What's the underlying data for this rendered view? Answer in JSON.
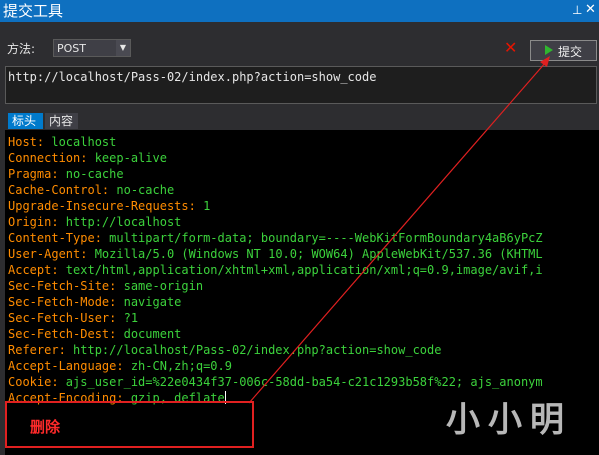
{
  "window": {
    "title": "提交工具",
    "pin_glyph": "⊥",
    "close_glyph": "✕"
  },
  "toolbar": {
    "method_label": "方法:",
    "method_value": "POST",
    "clear_glyph": "✕",
    "submit_label": "提交"
  },
  "url": "http://localhost/Pass-02/index.php?action=show_code",
  "tabs": [
    {
      "label": "标头",
      "active": true
    },
    {
      "label": "内容",
      "active": false
    }
  ],
  "headers": [
    {
      "k": "Host:",
      "v": " localhost"
    },
    {
      "k": "Connection:",
      "v": " keep-alive"
    },
    {
      "k": "Pragma:",
      "v": " no-cache"
    },
    {
      "k": "Cache-Control:",
      "v": " no-cache"
    },
    {
      "k": "Upgrade-Insecure-Requests:",
      "v": " 1"
    },
    {
      "k": "Origin:",
      "v": " http://localhost"
    },
    {
      "k": "Content-Type:",
      "v": " multipart/form-data; boundary=----WebKitFormBoundary4aB6yPcZ"
    },
    {
      "k": "User-Agent:",
      "v": " Mozilla/5.0 (Windows NT 10.0; WOW64) AppleWebKit/537.36 (KHTML"
    },
    {
      "k": "Accept:",
      "v": " text/html,application/xhtml+xml,application/xml;q=0.9,image/avif,i"
    },
    {
      "k": "Sec-Fetch-Site:",
      "v": " same-origin"
    },
    {
      "k": "Sec-Fetch-Mode:",
      "v": " navigate"
    },
    {
      "k": "Sec-Fetch-User:",
      "v": " ?1"
    },
    {
      "k": "Sec-Fetch-Dest:",
      "v": " document"
    },
    {
      "k": "Referer:",
      "v": " http://localhost/Pass-02/index.php?action=show_code"
    },
    {
      "k": "Accept-Language:",
      "v": " zh-CN,zh;q=0.9"
    },
    {
      "k": "Cookie:",
      "v": " ajs_user_id=%22e0434f37-006c-58dd-ba54-c21c1293b58f%22; ajs_anonym"
    },
    {
      "k": "Accept-Encoding:",
      "v": " gzip, deflate"
    }
  ],
  "annotation": {
    "label": "删除",
    "color": "#e02020"
  },
  "watermark": "小小明",
  "colors": {
    "header_key": "#ff8c00",
    "header_value": "#3cd23c",
    "titlebar": "#0e70c0",
    "accent_tab": "#007acc"
  }
}
